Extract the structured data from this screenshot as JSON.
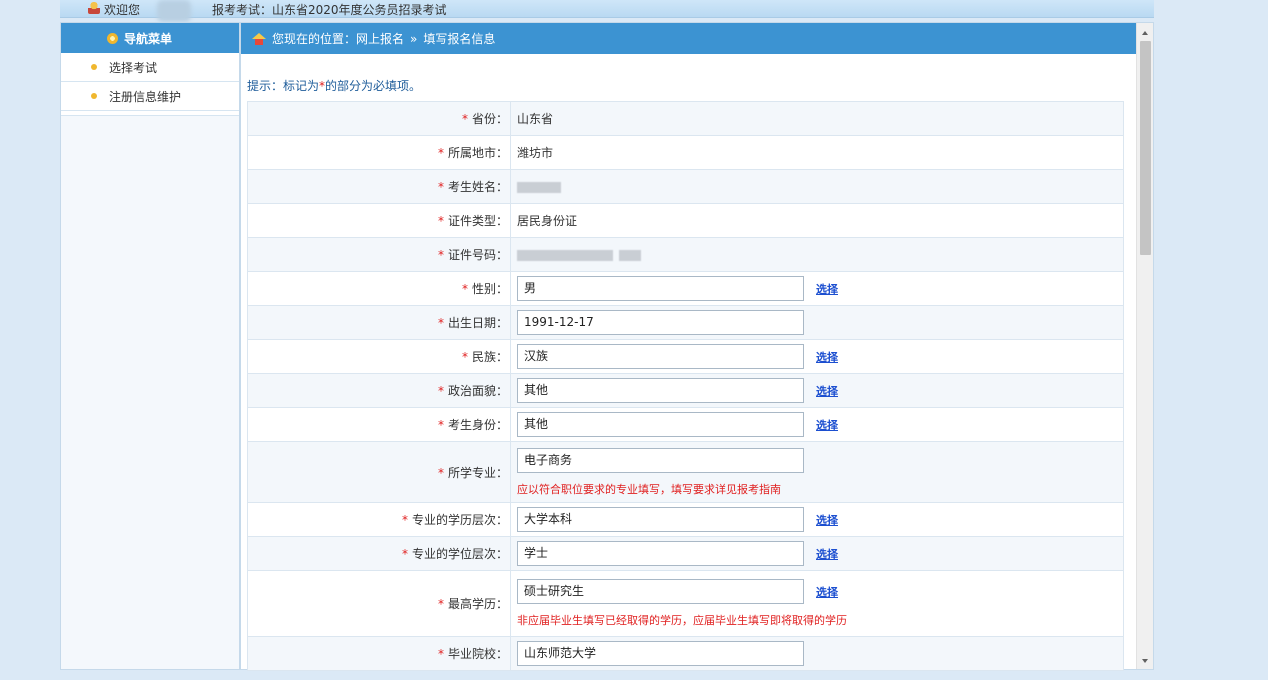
{
  "topbar": {
    "welcome": "欢迎您",
    "exam_info": "报考考试：山东省2020年度公务员招录考试"
  },
  "sidebar": {
    "header": "导航菜单",
    "items": [
      {
        "label": "选择考试"
      },
      {
        "label": "注册信息维护"
      }
    ]
  },
  "breadcrumb": {
    "prefix": "您现在的位置：网上报名",
    "separator": "»",
    "current": "填写报名信息"
  },
  "hint": {
    "before": "提示：标记为",
    "star": "*",
    "after": "的部分为必填项。"
  },
  "form": {
    "rows": [
      {
        "label": "省份：",
        "value": "山东省"
      },
      {
        "label": "所属地市：",
        "value": "潍坊市"
      },
      {
        "label": "考生姓名：",
        "value": ""
      },
      {
        "label": "证件类型：",
        "value": "居民身份证"
      },
      {
        "label": "证件号码：",
        "value": ""
      },
      {
        "label": "性别：",
        "value": "男",
        "select": "选择"
      },
      {
        "label": "出生日期：",
        "value": "1991-12-17"
      },
      {
        "label": "民族：",
        "value": "汉族",
        "select": "选择"
      },
      {
        "label": "政治面貌：",
        "value": "其他",
        "select": "选择"
      },
      {
        "label": "考生身份：",
        "value": "其他",
        "select": "选择"
      },
      {
        "label": "所学专业：",
        "value": "电子商务",
        "note": "应以符合职位要求的专业填写，填写要求详见报考指南"
      },
      {
        "label": "专业的学历层次：",
        "value": "大学本科",
        "select": "选择"
      },
      {
        "label": "专业的学位层次：",
        "value": "学士",
        "select": "选择"
      },
      {
        "label": "最高学历：",
        "value": "硕士研究生",
        "select": "选择",
        "note": "非应届毕业生填写已经取得的学历，应届毕业生填写即将取得的学历"
      },
      {
        "label": "毕业院校：",
        "value": "山东师范大学"
      }
    ]
  }
}
